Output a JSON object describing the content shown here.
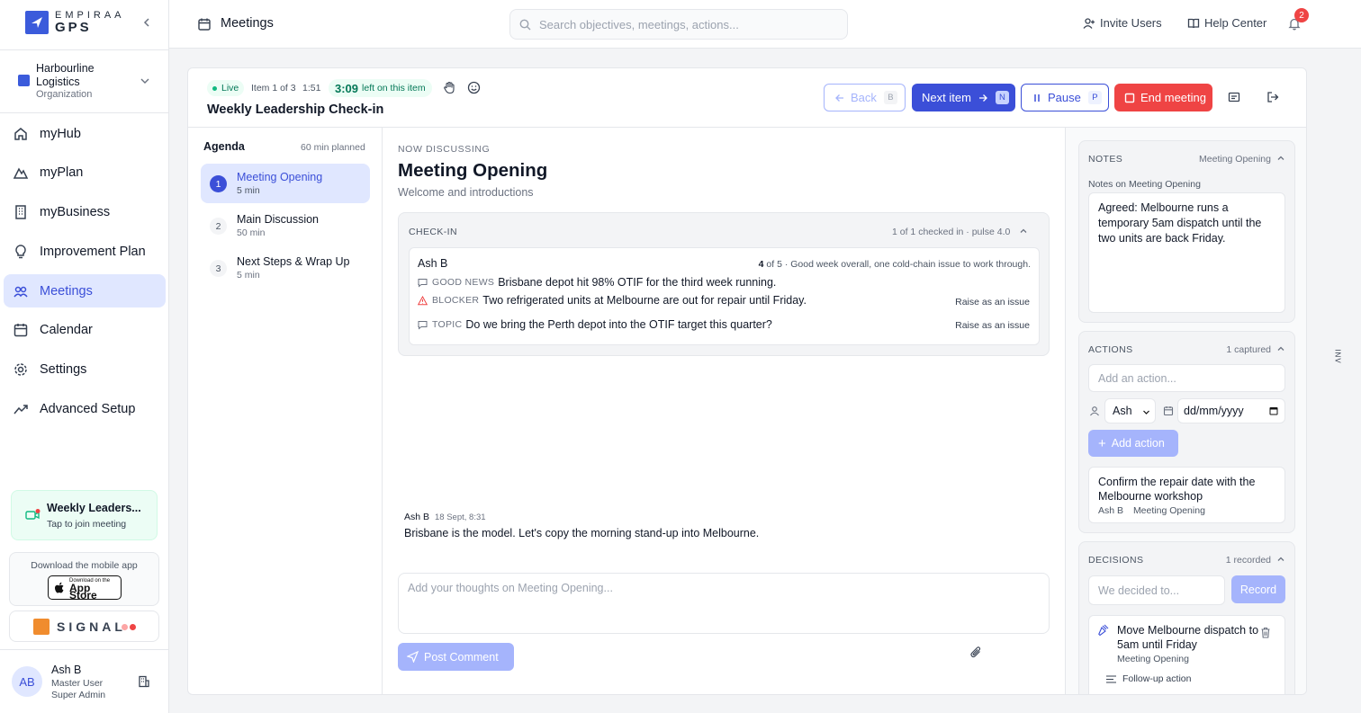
{
  "brand": {
    "name_top": "EMPIRAA",
    "name_bottom": "GPS"
  },
  "organization": {
    "name": "Harbourline Logistics",
    "type": "Organization"
  },
  "nav": {
    "items": [
      {
        "label": "myHub",
        "icon": "home-icon"
      },
      {
        "label": "myPlan",
        "icon": "mountain-icon"
      },
      {
        "label": "myBusiness",
        "icon": "building-icon"
      },
      {
        "label": "Improvement Plan",
        "icon": "lightbulb-icon"
      },
      {
        "label": "Meetings",
        "icon": "calendar-icon",
        "active": true
      },
      {
        "label": "Calendar",
        "icon": "calendar-icon"
      },
      {
        "label": "Settings",
        "icon": "gear-icon"
      },
      {
        "label": "Advanced Setup",
        "icon": "trend-icon"
      }
    ]
  },
  "join_card": {
    "title": "Weekly Leaders...",
    "subtitle": "Tap to join meeting"
  },
  "mobile_card": {
    "title": "Download the mobile app",
    "store_small": "Download on the",
    "store_big": "App Store"
  },
  "signal": {
    "text": "SIGNAL"
  },
  "user": {
    "initials": "AB",
    "name": "Ash B",
    "role": "Master User",
    "role2": "Super Admin"
  },
  "topbar": {
    "page_title": "Meetings",
    "search_placeholder": "Search objectives, meetings, actions...",
    "invite_label": "Invite Users",
    "help_label": "Help Center",
    "notification_count": "2"
  },
  "meeting": {
    "status": "Live",
    "item_position": "Item 1 of 3",
    "elapsed": "1:51",
    "time_left": "3:09",
    "time_left_suffix": "left on this item",
    "title": "Weekly Leadership Check-in",
    "buttons": {
      "back": "Back",
      "back_key": "B",
      "next": "Next item",
      "next_key": "N",
      "pause": "Pause",
      "pause_key": "P",
      "end": "End meeting"
    }
  },
  "agenda": {
    "title": "Agenda",
    "planned": "60 min planned",
    "items": [
      {
        "num": "1",
        "name": "Meeting Opening",
        "duration": "5 min",
        "active": true
      },
      {
        "num": "2",
        "name": "Main Discussion",
        "duration": "50 min"
      },
      {
        "num": "3",
        "name": "Next Steps & Wrap Up",
        "duration": "5 min"
      }
    ]
  },
  "discussion": {
    "label": "NOW DISCUSSING",
    "title": "Meeting Opening",
    "subtitle": "Welcome and introductions",
    "checkin": {
      "label": "CHECK-IN",
      "stats": "1 of 1 checked in · pulse 4.0",
      "entry": {
        "name": "Ash B",
        "score": "4",
        "score_rest": "of 5 · Good week overall, one cold-chain issue to work through.",
        "rows": [
          {
            "tag": "GOOD NEWS",
            "text": "Brisbane depot hit 98% OTIF for the third week running.",
            "icon": "message-icon"
          },
          {
            "tag": "BLOCKER",
            "text": "Two refrigerated units at Melbourne are out for repair until Friday.",
            "icon": "warning-icon",
            "action": "Raise as an issue"
          },
          {
            "tag": "TOPIC",
            "text": "Do we bring the Perth depot into the OTIF target this quarter?",
            "icon": "message-icon",
            "action": "Raise as an issue"
          }
        ]
      }
    },
    "comment": {
      "author": "Ash B",
      "time": "18 Sept, 8:31",
      "body": "Brisbane is the model. Let's copy the morning stand-up into Melbourne."
    },
    "composer_placeholder": "Add your thoughts on Meeting Opening...",
    "post_label": "Post Comment"
  },
  "notes": {
    "label": "NOTES",
    "meta": "Meeting Opening",
    "sub": "Notes on Meeting Opening",
    "text": "Agreed: Melbourne runs a temporary 5am dispatch until the two units are back Friday."
  },
  "actions": {
    "label": "ACTIONS",
    "meta": "1 captured",
    "input_placeholder": "Add an action...",
    "assignee": "Ash",
    "date_placeholder": "dd/mm/yyyy",
    "add_label": "Add action",
    "items": [
      {
        "title": "Confirm the repair date with the Melbourne workshop",
        "owner": "Ash B",
        "item": "Meeting Opening"
      }
    ]
  },
  "decisions": {
    "label": "DECISIONS",
    "meta": "1 recorded",
    "input_placeholder": "We decided to...",
    "record_label": "Record",
    "items": [
      {
        "title": "Move Melbourne dispatch to 5am until Friday",
        "item": "Meeting Opening",
        "followup": "Follow-up action"
      }
    ]
  },
  "edge_tab": {
    "text": "INV"
  },
  "colors": {
    "accent": "#3b4fd8",
    "danger": "#ef4444",
    "live": "#10b981"
  }
}
